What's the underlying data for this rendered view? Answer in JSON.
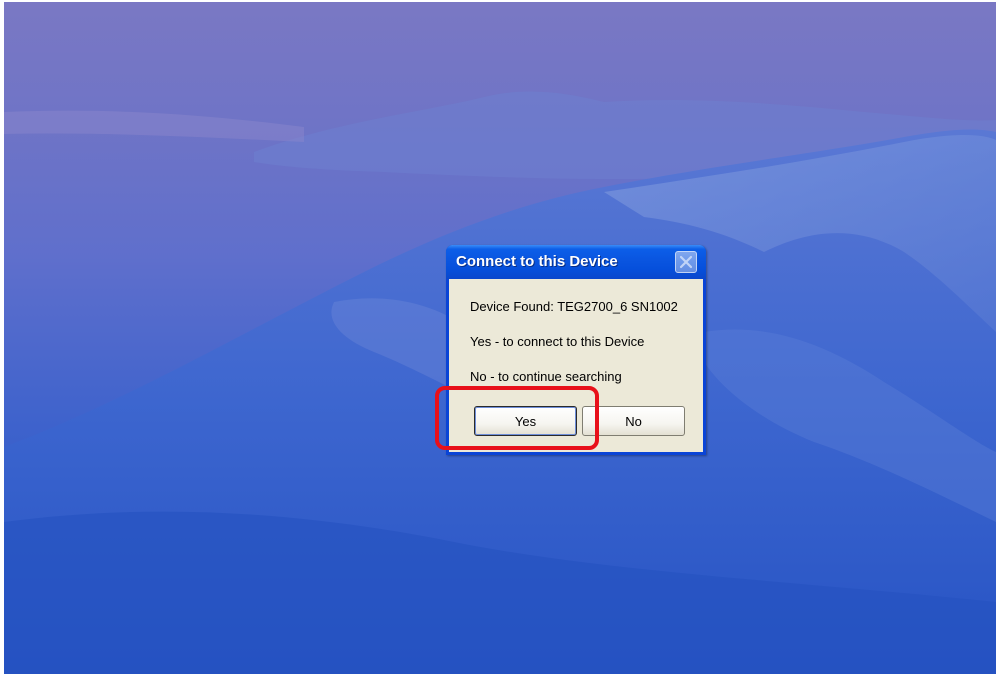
{
  "dialog": {
    "title": "Connect to this Device",
    "close_icon": "close-icon",
    "messages": {
      "device_found": "Device Found: TEG2700_6 SN1002",
      "yes_hint": "Yes - to connect to this Device",
      "no_hint": "No - to continue searching"
    },
    "buttons": {
      "yes": "Yes",
      "no": "No"
    }
  },
  "annotation": {
    "color": "#e8101a",
    "target": "yes-button"
  },
  "colors": {
    "titlebar": "#0a55e0",
    "dialog_bg": "#ece9d8",
    "desktop": "#3f63cc"
  }
}
